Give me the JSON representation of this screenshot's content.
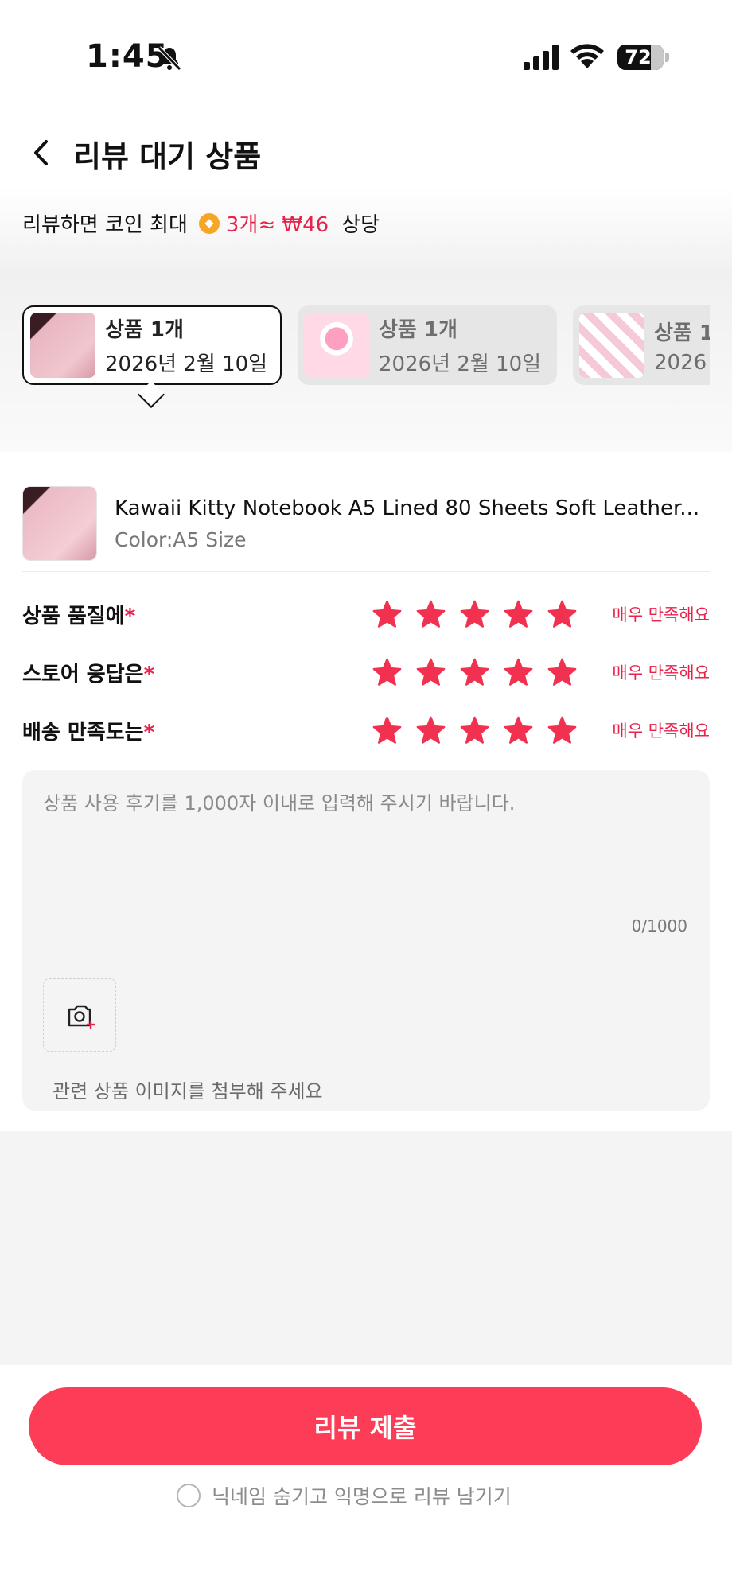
{
  "status_bar": {
    "time": "1:45",
    "battery": "72",
    "battery_level": 0.72
  },
  "header": {
    "title": "리뷰 대기 상품"
  },
  "promo": {
    "text": "리뷰하면 코인 최대",
    "reward": "3개≈ ₩46",
    "suffix": "상당"
  },
  "tabs": [
    {
      "title": "상품 1개",
      "date": "2026년 2월 10일",
      "active": true
    },
    {
      "title": "상품 1개",
      "date": "2026년 2월 10일",
      "active": false
    },
    {
      "title": "상품 1",
      "date": "2026",
      "active": false
    }
  ],
  "product": {
    "name": "Kawaii Kitty Notebook A5 Lined 80 Sheets Soft Leather...",
    "variant": "Color:A5 Size"
  },
  "ratings": [
    {
      "label": "상품 품질에",
      "required_mark": "*",
      "stars": 5,
      "max": 5,
      "text": "매우 만족해요"
    },
    {
      "label": "스토어 응답은",
      "required_mark": "*",
      "stars": 5,
      "max": 5,
      "text": "매우 만족해요"
    },
    {
      "label": "배송 만족도는",
      "required_mark": "*",
      "stars": 5,
      "max": 5,
      "text": "매우 만족해요"
    }
  ],
  "review": {
    "placeholder": "상품 사용 후기를 1,000자 이내로 입력해 주시기 바랍니다.",
    "counter": "0/1000",
    "photo_hint": "관련 상품 이미지를 첨부해 주세요"
  },
  "footer": {
    "submit_label": "리뷰 제출",
    "anonymous_label": "닉네임 숨기고 익명으로 리뷰 남기기"
  },
  "colors": {
    "accent": "#e8224a",
    "button": "#fd3d57",
    "star": "#f2304f"
  },
  "icons": [
    "bell-slash-icon",
    "signal-icon",
    "wifi-icon",
    "battery-icon",
    "back-chevron-icon",
    "coin-icon",
    "star-icon",
    "camera-add-icon",
    "radio-icon"
  ]
}
